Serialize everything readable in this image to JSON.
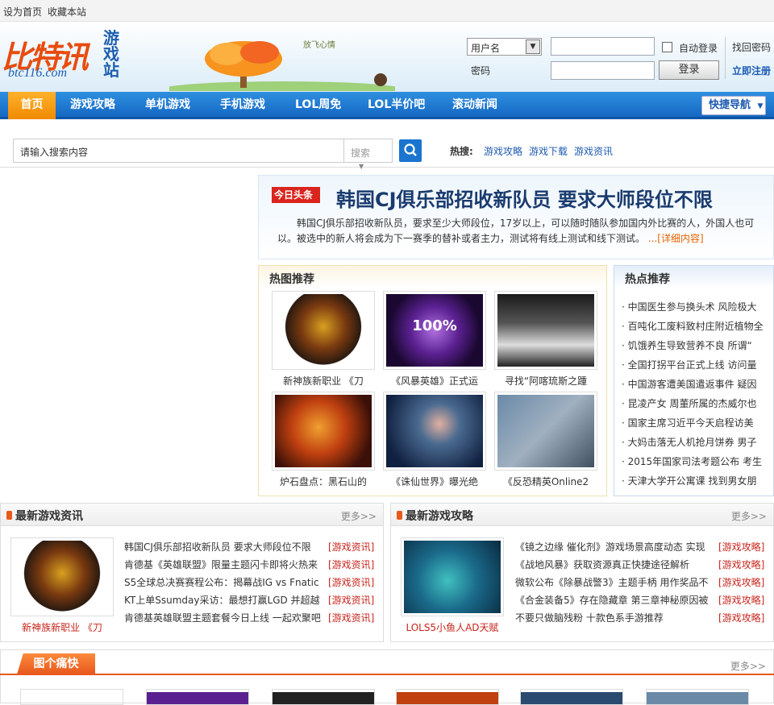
{
  "topbar": {
    "set_home": "设为首页",
    "bookmark": "收藏本站"
  },
  "logo": {
    "main": "比特讯",
    "side": "游戏站",
    "url": "btc116.com",
    "tree_text": "放飞心情"
  },
  "login": {
    "select_value": "用户名",
    "password_label": "密码",
    "auto_login": "自动登录",
    "login_button": "登录",
    "forgot": "找回密码",
    "register": "立即注册"
  },
  "nav": {
    "items": [
      "首页",
      "游戏攻略",
      "单机游戏",
      "手机游戏",
      "LOL周免",
      "LOL半价吧",
      "滚动新闻"
    ],
    "quick": "快捷导航"
  },
  "search": {
    "placeholder": "请输入搜索内容",
    "type": "搜索",
    "hot_label": "热搜:",
    "hot_links": [
      "游戏攻略",
      "游戏下载",
      "游戏资讯"
    ]
  },
  "headline": {
    "badge": "今日头条",
    "title": "韩国CJ俱乐部招收新队员 要求大师段位不限",
    "text": "韩国CJ俱乐部招收新队员，要求至少大师段位，17岁以上，可以随时随队参加国内外比赛的人，外国人也可以。被选中的新人将会成为下一赛季的替补或者主力，测试将有线上测试和线下测试。",
    "more": "...[详细内容]"
  },
  "hotpics": {
    "title": "热图推荐",
    "captions": [
      "新神族新职业 《刀",
      "《风暴英雄》正式运",
      "寻找“阿喀琉斯之踵",
      "炉石盘点：黑石山的",
      "《诛仙世界》曝光绝",
      "《反恐精英Online2"
    ],
    "badge_text": "100%"
  },
  "hotrec": {
    "title": "热点推荐",
    "items": [
      "中国医生参与换头术 风险极大",
      "百吨化工废料致村庄附近植物全",
      "饥饿养生导致营养不良 所谓“",
      "全国打拐平台正式上线 访问量",
      "中国游客遭美国遣返事件 疑因",
      "昆凌产女 周董所属的杰威尔也",
      "国家主席习近平今天启程访美",
      "大妈击落无人机抢月饼券 男子",
      "2015年国家司法考题公布 考生",
      "天津大学开公寓课 找到男女朋"
    ]
  },
  "news": {
    "title": "最新游戏资讯",
    "more": "更多>>",
    "caption": "新神族新职业 《刀",
    "items": [
      "韩国CJ俱乐部招收新队员 要求大师段位不限",
      "肯德基《英雄联盟》限量主题闪卡即将火热来",
      "S5全球总决赛赛程公布：揭幕战IG vs Fnatic",
      "KT上单Ssumday采访：最想打赢LGD 并超越",
      "肯德基英雄联盟主题套餐今日上线 一起欢聚吧"
    ],
    "tag": "[游戏资讯]"
  },
  "guides": {
    "title": "最新游戏攻略",
    "more": "更多>>",
    "caption": "LOLS5小鱼人AD天赋",
    "items": [
      "《镜之边缘 催化剂》游戏场景高度动态 实现",
      "《战地风暴》获取资源真正快捷途径解析",
      "微软公布《除暴战警3》主题手柄 用作奖品不",
      "《合金装备5》存在隐藏章 第三章神秘原因被",
      "不要只做脑残粉 十款色系手游推荐"
    ],
    "tag": "[游戏攻略]"
  },
  "pics": {
    "title": "图个痛快",
    "more": "更多>>"
  },
  "colors": {
    "nav_blue": "#1568c3",
    "accent_orange": "#f08a00",
    "tag_red": "#c8241b",
    "link_blue": "#1d5ab0"
  }
}
